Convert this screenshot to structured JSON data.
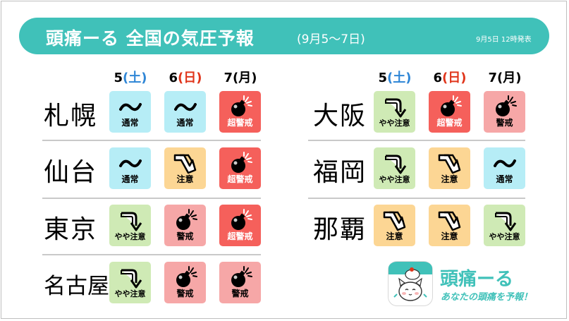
{
  "header": {
    "title": "頭痛ーる 全国の気圧予報",
    "subtitle": "(9月5〜7日)",
    "announcement": "9月5日 12時発表"
  },
  "days": [
    {
      "num": "5",
      "weekday": "(土)",
      "weekday_type": "sat"
    },
    {
      "num": "6",
      "weekday": "(日)",
      "weekday_type": "sun"
    },
    {
      "num": "7",
      "weekday": "(月)",
      "weekday_type": "weekday"
    }
  ],
  "levels": {
    "normal": {
      "label": "通常",
      "icon": "tilde-wave-icon",
      "color": "#b6edf6"
    },
    "slight": {
      "label": "やや注意",
      "icon": "down-arrow-icon",
      "color": "#cfeab5"
    },
    "caution": {
      "label": "注意",
      "icon": "double-down-arrow-icon",
      "color": "#fcd694"
    },
    "warning": {
      "label": "警戒",
      "icon": "bomb-icon",
      "color": "#f6a7a7"
    },
    "super": {
      "label": "超警戒",
      "icon": "bomb-icon",
      "color": "#f5605b"
    }
  },
  "cities_left": [
    {
      "name": "札幌",
      "forecast": [
        "normal",
        "normal",
        "super"
      ]
    },
    {
      "name": "仙台",
      "forecast": [
        "normal",
        "caution",
        "super"
      ]
    },
    {
      "name": "東京",
      "forecast": [
        "slight",
        "warning",
        "super"
      ]
    },
    {
      "name": "名古屋",
      "forecast": [
        "slight",
        "warning",
        "warning"
      ]
    }
  ],
  "cities_right": [
    {
      "name": "大阪",
      "forecast": [
        "slight",
        "super",
        "warning"
      ]
    },
    {
      "name": "福岡",
      "forecast": [
        "slight",
        "caution",
        "normal"
      ]
    },
    {
      "name": "那覇",
      "forecast": [
        "caution",
        "caution",
        "slight"
      ]
    }
  ],
  "brand": {
    "name": "頭痛ーる",
    "tagline": "あなたの頭痛を予報！",
    "accent": "#40c1b9"
  }
}
